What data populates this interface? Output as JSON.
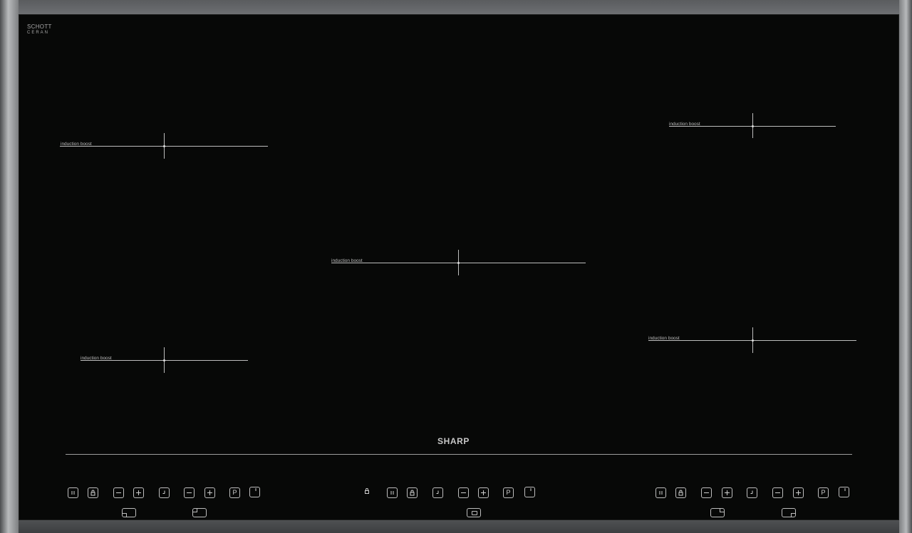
{
  "cooktop": {
    "glass_brand": {
      "line1": "SCHOTT",
      "line2": "CERAN"
    },
    "brand": "SHARP",
    "zones": [
      {
        "label": "induction boost"
      },
      {
        "label": "induction boost"
      },
      {
        "label": "induction boost"
      },
      {
        "label": "induction boost"
      },
      {
        "label": "induction boost"
      }
    ],
    "controls": {
      "left": [
        "pause-icon",
        "lock-icon",
        "minus-icon",
        "plus-icon",
        "timer-icon",
        "minus-icon",
        "plus-icon",
        "p-icon",
        "power-icon"
      ],
      "center": [
        "pause-icon",
        "lock-icon",
        "timer-icon",
        "minus-icon",
        "plus-icon",
        "p-icon",
        "power-icon"
      ],
      "right": [
        "pause-icon",
        "lock-icon",
        "minus-icon",
        "plus-icon",
        "timer-icon",
        "minus-icon",
        "plus-icon",
        "p-icon",
        "power-icon"
      ]
    },
    "key_symbols": {
      "p": "P"
    },
    "colors": {
      "glass": "#070807",
      "lines": "#bdbdbd",
      "frame": "#8b8d8f"
    }
  }
}
